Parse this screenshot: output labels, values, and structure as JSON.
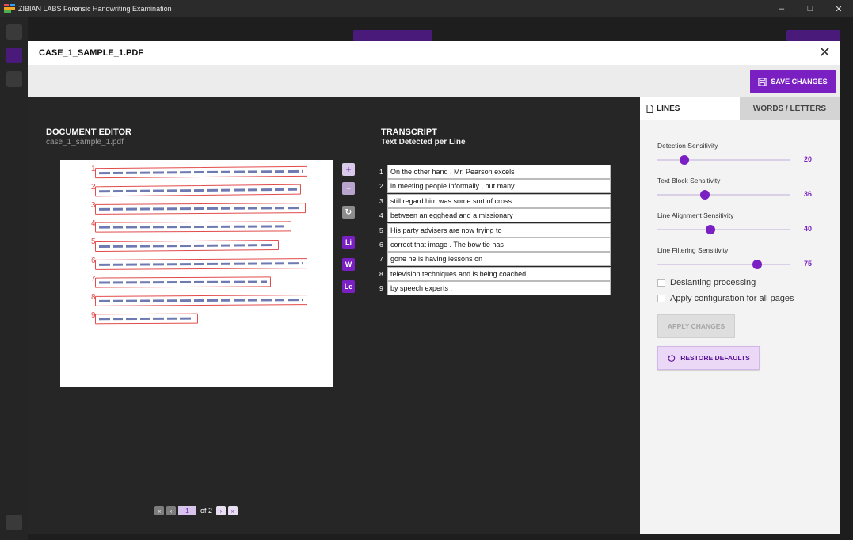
{
  "window": {
    "title": "ZIBIAN LABS Forensic Handwriting Examination",
    "icon": "app-logo-icon",
    "controls": [
      "minimize-icon",
      "maximize-icon",
      "close-icon"
    ]
  },
  "modal": {
    "filename": "CASE_1_SAMPLE_1.PDF",
    "save_label": "SAVE CHANGES",
    "close_glyph": "✕"
  },
  "editor": {
    "title": "DOCUMENT EDITOR",
    "subtitle": "case_1_sample_1.pdf",
    "line_numbers": [
      "1",
      "2",
      "3",
      "4",
      "5",
      "6",
      "7",
      "8",
      "9"
    ]
  },
  "tools": {
    "zoom_in": "+",
    "zoom_out": "−",
    "rotate": "↻",
    "lines": "Li",
    "words": "W",
    "letters": "Le"
  },
  "transcript": {
    "title": "TRANSCRIPT",
    "subtitle": "Text Detected per Line",
    "lines": [
      {
        "num": "1",
        "text": "On the other hand , Mr. Pearson excels"
      },
      {
        "num": "2",
        "text": "in meeting people informally , but many"
      },
      {
        "num": "3",
        "text": "still regard him was some sort of cross"
      },
      {
        "num": "4",
        "text": "between an egghead and a missionary"
      },
      {
        "num": "5",
        "text": "His party advisers are now trying to"
      },
      {
        "num": "6",
        "text": "correct that image . The bow tie has"
      },
      {
        "num": "7",
        "text": "gone  he is having lessons on"
      },
      {
        "num": "8",
        "text": "television techniques and is being coached"
      },
      {
        "num": "9",
        "text": "by speech experts ."
      }
    ]
  },
  "pager": {
    "first": "«",
    "prev": "‹",
    "current": "1",
    "of_label": "of 2",
    "next": "›",
    "last": "»"
  },
  "panel": {
    "tab_lines": "LINES",
    "tab_words": "WORDS / LETTERS",
    "sliders": [
      {
        "label": "Detection Sensitivity",
        "value": "20",
        "fraction": 0.2
      },
      {
        "label": "Text Block Sensitivity",
        "value": "36",
        "fraction": 0.36
      },
      {
        "label": "Line Alignment Sensitivity",
        "value": "40",
        "fraction": 0.4
      },
      {
        "label": "Line Filtering Sensitivity",
        "value": "75",
        "fraction": 0.75
      }
    ],
    "deslant_label": "Deslanting processing",
    "apply_all_label": "Apply configuration for all pages",
    "apply_label": "APPLY CHANGES",
    "restore_label": "RESTORE DEFAULTS"
  },
  "colors": {
    "accent": "#7a1fc2",
    "annotation": "#e24b4b"
  }
}
